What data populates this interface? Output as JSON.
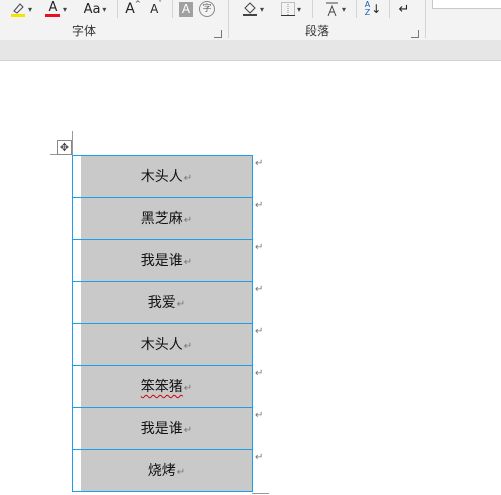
{
  "ribbon": {
    "font_group": {
      "label": "字体",
      "highlight_icon": "highlighter-icon",
      "font_color_glyph": "A",
      "font_color_icon": "font-color-icon",
      "change_case_glyph": "Aa",
      "grow_font_glyph": "A",
      "shrink_font_glyph": "A",
      "char_shading_glyph": "A",
      "enclose_char_glyph": "字",
      "highlight_color": "#f2e600",
      "font_color": "#e81123"
    },
    "paragraph_group": {
      "label": "段落",
      "shading_icon": "paint-bucket-icon",
      "borders_icon": "borders-icon",
      "sort_icon": "sort-icon",
      "sort_glyph": "A\nZ",
      "asian_layout_icon": "asian-layout-icon",
      "show_marks_icon": "show-marks-icon"
    }
  },
  "table": {
    "rows": [
      {
        "text": "木头人",
        "misspelled": false
      },
      {
        "text": "黑芝麻",
        "misspelled": false
      },
      {
        "text": "我是谁",
        "misspelled": false
      },
      {
        "text": "我爱",
        "misspelled": false
      },
      {
        "text": "木头人",
        "misspelled": false
      },
      {
        "text": "笨笨猪",
        "misspelled": true
      },
      {
        "text": "我是谁",
        "misspelled": false
      },
      {
        "text": "烧烤",
        "misspelled": false
      }
    ],
    "cell_mark": "↵",
    "row_end_mark": "↵",
    "shading_color": "#c9c9c9",
    "border_color": "#1e9ee6"
  }
}
